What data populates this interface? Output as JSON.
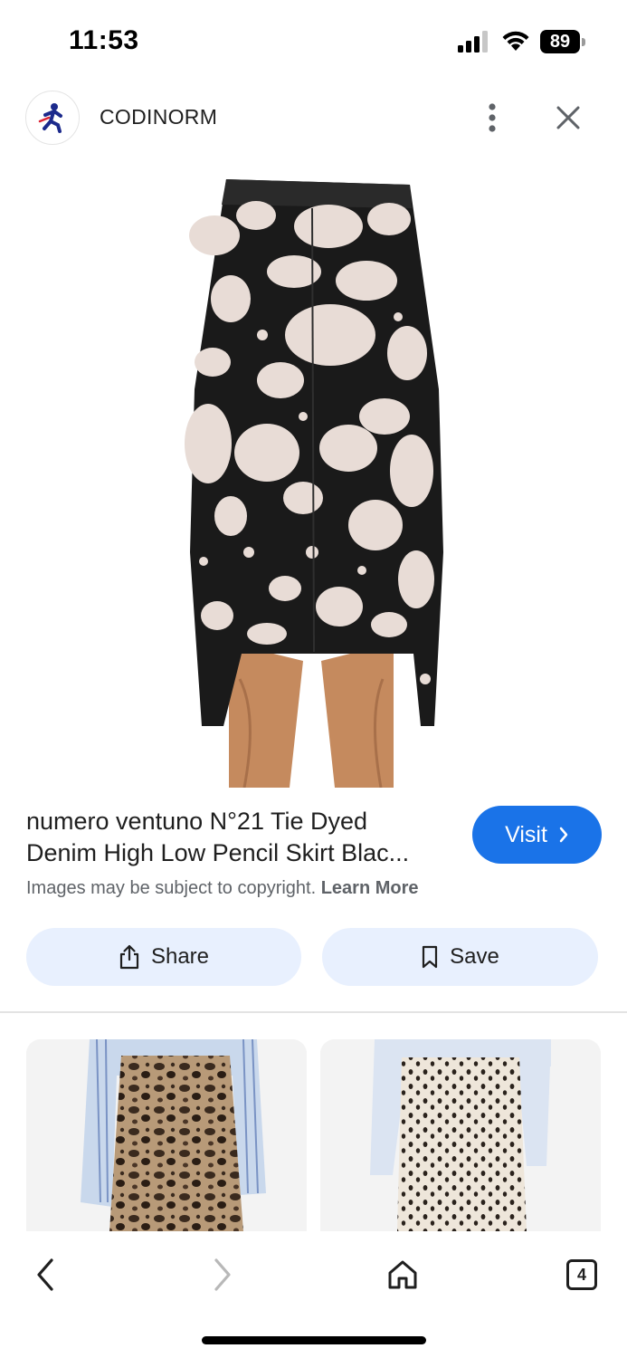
{
  "status_bar": {
    "time": "11:53",
    "battery": "89"
  },
  "header": {
    "site_name": "CODINORM",
    "icons": {
      "logo": "runner-logo",
      "more": "more-vert-icon",
      "close": "close-icon"
    }
  },
  "product": {
    "title_line1": "numero ventuno N°21 Tie Dyed",
    "title_line2": "Denim High Low Pencil Skirt Blac...",
    "visit_label": "Visit",
    "copyright_text": "Images may be subject to copyright.",
    "learn_more": "Learn More",
    "accent_color": "#1a73e8"
  },
  "actions": {
    "share_label": "Share",
    "save_label": "Save"
  },
  "toolbar": {
    "tab_count": "4"
  }
}
